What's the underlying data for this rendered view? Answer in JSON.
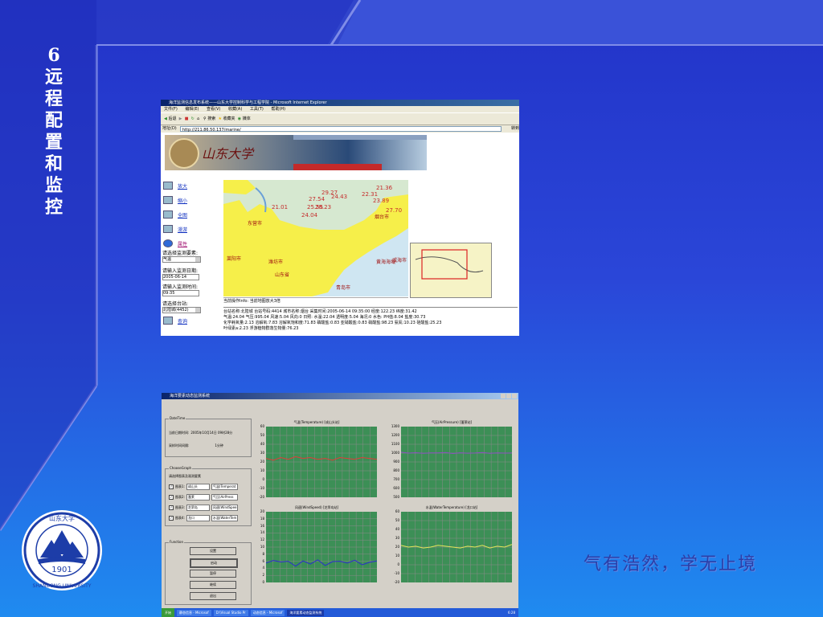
{
  "slide": {
    "title_chars": [
      "6",
      "远",
      "程",
      "配",
      "置",
      "和",
      "监",
      "控"
    ],
    "motto": "气有浩然，学无止境",
    "logo_text": {
      "top": "山东大学",
      "year": "1901",
      "bottom": "SHANDONG UNIVERSITY"
    }
  },
  "browser": {
    "title": "海洋监测信息发布系统——山东大学控制科学与工程学院 - Microsoft Internet Explorer",
    "menu": [
      "文件(F)",
      "编辑(E)",
      "查看(V)",
      "收藏(A)",
      "工具(T)",
      "帮助(H)"
    ],
    "toolbar": [
      "后退",
      "搜索",
      "收藏夹",
      "媒体"
    ],
    "address_label": "地址(D)",
    "address": "http://211.86.50.137/marine/",
    "go_label": "转到",
    "banner_name": "山东大学",
    "map_menu": [
      {
        "label": "放大",
        "icon": "zoom-in-icon"
      },
      {
        "label": "缩小",
        "icon": "zoom-out-icon"
      },
      {
        "label": "全图",
        "icon": "globe-icon"
      },
      {
        "label": "漫游",
        "icon": "pan-icon"
      },
      {
        "label": "属性",
        "icon": "info-icon"
      }
    ],
    "controls": {
      "element_label": "请选择监测要素:",
      "element_value": "气温",
      "date_label": "请输入监测日期:",
      "date_value": "2005-06-14",
      "time_label": "请输入监测时间:",
      "time_value": "09:35",
      "station_label": "请选择台站:",
      "station_value": "北隍城(4452)",
      "query_label": "查询"
    },
    "map_labels": [
      "21.36",
      "29.27",
      "24.43",
      "22.31",
      "27.54",
      "23.89",
      "21.01",
      "25.55",
      "28.23",
      "27.70",
      "24.04"
    ],
    "map_places": [
      "东营市",
      "潍坊市",
      "烟台市",
      "威海市",
      "黄海海域",
      "山东省",
      "青岛市",
      "莱阳市"
    ],
    "status": "当前操作Info: 当前地图放大3倍",
    "info_lines": [
      "台站名称:北隍城 台站号码:4414 城市名称:烟台 采集时间:2005-06-14 09:35:00 经度:122.23 纬度:31.42",
      "气温:24.04 气压:995.04 风速:5.04 风向:0 日照: 水温:22.04 透明度:5.04 海况:0 水色: PH值:8.04 盐度:30.73",
      "化学耗氧量:2.13 溶解氧:7.83 溶解氧饱和度:71.83 磷酸盐:0.83 亚硝酸盐:0.83 硝酸盐:98.23 氨氮:10.23 硅酸盐:25.23",
      "叶绿素a:2.23 浮游植物群落生物量:76.23"
    ]
  },
  "app": {
    "title": "海洋要素动态监测系统",
    "datetime": {
      "caption": "DateTime",
      "current_label": "当前日期时间:",
      "current_value": "2005年10月14日 09时28分",
      "interval_label": "采样时间间隔:",
      "interval_value": "1分钟"
    },
    "choose": {
      "caption": "ChooseGraph",
      "hint": "请选择图表及观测要素",
      "rows": [
        {
          "label": "图表1:",
          "station": "成山头",
          "element": "气温(Temperat"
        },
        {
          "label": "图表2:",
          "station": "蓬莱",
          "element": "气压(AirPress"
        },
        {
          "label": "图表3:",
          "station": "芝罘岛",
          "element": "风速(WindSpee"
        },
        {
          "label": "图表4:",
          "station": "龙口",
          "element": "水温(WaterTem"
        }
      ]
    },
    "function": {
      "caption": "Function",
      "buttons": [
        "设置",
        "启动",
        "暂停",
        "继续",
        "退出"
      ]
    },
    "charts": [
      {
        "title": "气温(Temperature)",
        "station": "[成山头站]",
        "yticks": [
          "60",
          "50",
          "40",
          "30",
          "20",
          "10",
          "0",
          "-10",
          "-20"
        ],
        "line_color": "#e33a3a"
      },
      {
        "title": "气压(AirPressure)",
        "station": "[蓬莱站]",
        "yticks": [
          "1300",
          "1200",
          "1100",
          "1000",
          "900",
          "800",
          "700",
          "600",
          "500"
        ],
        "line_color": "#8e4fc3"
      },
      {
        "title": "风速(WindSpeed)",
        "station": "[芝罘岛站]",
        "yticks": [
          "20",
          "18",
          "16",
          "14",
          "12",
          "10",
          "8",
          "6",
          "4",
          "2",
          "0"
        ],
        "line_color": "#2b2bd0"
      },
      {
        "title": "水温(WaterTemperature)",
        "station": "[龙口站]",
        "yticks": [
          "60",
          "50",
          "40",
          "30",
          "20",
          "10",
          "0",
          "-10",
          "-20"
        ],
        "line_color": "#e6e65a"
      }
    ],
    "taskbar": [
      "开始",
      "静态信息 - Microsof",
      "D:\\Visual Studio Pr",
      "动态信息 - Microsof",
      "海洋要素动态监测系统",
      "6:28"
    ]
  },
  "chart_data": [
    {
      "type": "line",
      "title": "气温(Temperature) [成山头站]",
      "ylim": [
        -20,
        60
      ],
      "series": [
        {
          "name": "气温",
          "values": [
            24,
            22,
            25,
            23,
            26,
            24,
            25,
            23,
            24,
            22,
            25,
            24,
            23,
            25,
            24,
            23
          ]
        }
      ]
    },
    {
      "type": "line",
      "title": "气压(AirPressure) [蓬莱站]",
      "ylim": [
        500,
        1300
      ],
      "series": [
        {
          "name": "气压",
          "values": [
            1010,
            1000,
            1005,
            998,
            1003,
            1002,
            1007,
            995,
            1004,
            999,
            1001,
            1006,
            997,
            1003,
            1000,
            1002
          ]
        }
      ]
    },
    {
      "type": "line",
      "title": "风速(WindSpeed) [芝罘岛站]",
      "ylim": [
        0,
        20
      ],
      "series": [
        {
          "name": "风速",
          "values": [
            5.5,
            6.2,
            5.8,
            6.0,
            4.6,
            6.1,
            5.2,
            6.4,
            4.8,
            5.9,
            6.0,
            5.5,
            6.3,
            5.0,
            5.7,
            6.1
          ]
        }
      ]
    },
    {
      "type": "line",
      "title": "水温(WaterTemperature) [龙口站]",
      "ylim": [
        -20,
        60
      ],
      "series": [
        {
          "name": "水温",
          "values": [
            22,
            20,
            21,
            19,
            20,
            22,
            21,
            20,
            19,
            21,
            20,
            22,
            19,
            21,
            20,
            23
          ]
        }
      ]
    }
  ]
}
